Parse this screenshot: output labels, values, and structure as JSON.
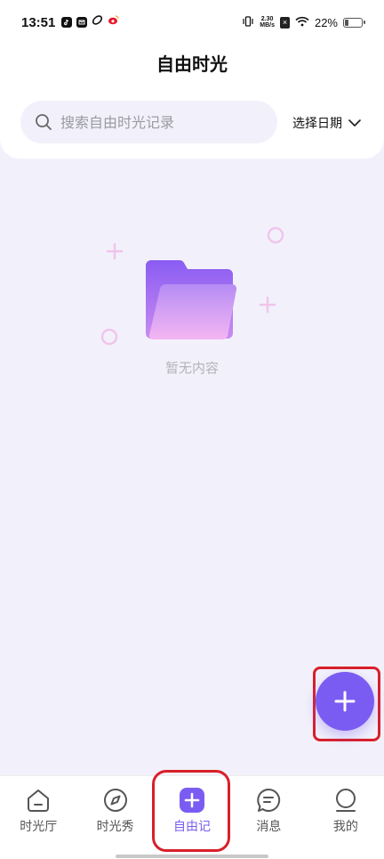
{
  "status_bar": {
    "time": "13:51",
    "speed_top": "2.30",
    "speed_bottom": "MB/s",
    "battery": "22%",
    "battery_level": 0.22
  },
  "header": {
    "title": "自由时光"
  },
  "search": {
    "placeholder": "搜索自由时光记录",
    "value": ""
  },
  "date_filter": {
    "label": "选择日期"
  },
  "empty_state": {
    "text": "暂无内容"
  },
  "nav": {
    "items": [
      {
        "label": "时光厅",
        "icon": "home-icon"
      },
      {
        "label": "时光秀",
        "icon": "compass-icon"
      },
      {
        "label": "自由记",
        "icon": "add-square-icon"
      },
      {
        "label": "消息",
        "icon": "message-icon"
      },
      {
        "label": "我的",
        "icon": "profile-icon"
      }
    ],
    "active_index": 2
  },
  "colors": {
    "accent": "#7b5cf2",
    "background": "#f2f1fb",
    "highlight": "#d8202a"
  }
}
